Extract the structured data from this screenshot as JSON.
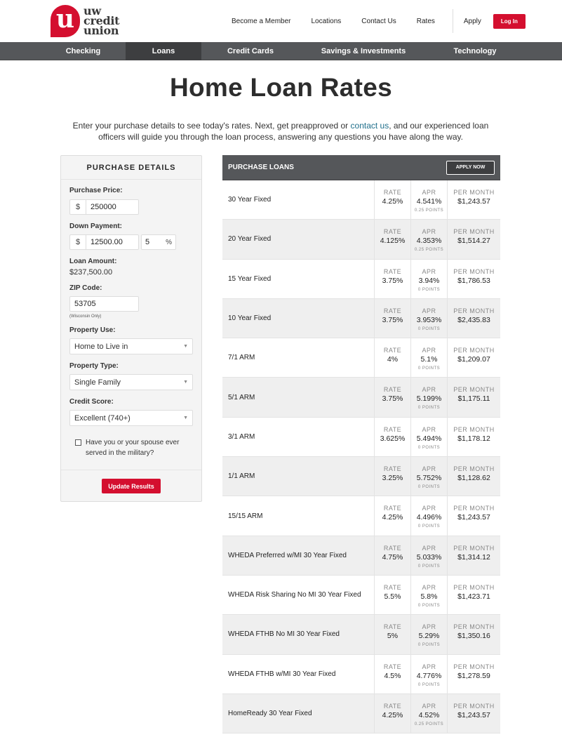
{
  "header": {
    "logo": {
      "mark": "u",
      "lines": [
        "uw",
        "credit",
        "union"
      ]
    },
    "top_links": [
      "Become a Member",
      "Locations",
      "Contact Us",
      "Rates"
    ],
    "apply_label": "Apply",
    "login_label": "Log In",
    "brand_color": "#d40f2f"
  },
  "main_nav": {
    "items": [
      {
        "label": "Checking",
        "active": false
      },
      {
        "label": "Loans",
        "active": true
      },
      {
        "label": "Credit Cards",
        "active": false
      },
      {
        "label": "Savings & Investments",
        "active": false
      },
      {
        "label": "Technology",
        "active": false
      }
    ]
  },
  "page": {
    "title": "Home Loan Rates",
    "intro_before": "Enter your purchase details to see today's rates. Next, get preapproved or ",
    "intro_link": "contact us",
    "intro_after": ", and our experienced loan officers will guide you through the loan process, answering any questions you have along the way."
  },
  "form": {
    "heading": "PURCHASE DETAILS",
    "purchase_price_label": "Purchase Price:",
    "currency_symbol": "$",
    "purchase_price": "250000",
    "down_payment_label": "Down Payment:",
    "down_payment": "12500.00",
    "down_payment_pct": "5",
    "pct_symbol": "%",
    "loan_amount_label": "Loan Amount:",
    "loan_amount": "$237,500.00",
    "zip_label": "ZIP Code:",
    "zip": "53705",
    "zip_hint": "(Wisconsin Only)",
    "property_use_label": "Property Use:",
    "property_use": "Home to Live in",
    "property_type_label": "Property Type:",
    "property_type": "Single Family",
    "credit_score_label": "Credit Score:",
    "credit_score": "Excellent (740+)",
    "military_label": "Have you or your spouse ever served in the military?",
    "military_checked": false,
    "update_label": "Update Results"
  },
  "rates": {
    "heading": "PURCHASE LOANS",
    "apply_now_label": "APPLY NOW",
    "col_labels": {
      "rate": "RATE",
      "apr": "APR",
      "per_month": "PER MONTH"
    },
    "rows": [
      {
        "name": "30 Year Fixed",
        "rate": "4.25%",
        "apr": "4.541%",
        "points": "0.25 POINTS",
        "per_month": "$1,243.57"
      },
      {
        "name": "20 Year Fixed",
        "rate": "4.125%",
        "apr": "4.353%",
        "points": "0.25 POINTS",
        "per_month": "$1,514.27"
      },
      {
        "name": "15 Year Fixed",
        "rate": "3.75%",
        "apr": "3.94%",
        "points": "0 POINTS",
        "per_month": "$1,786.53"
      },
      {
        "name": "10 Year Fixed",
        "rate": "3.75%",
        "apr": "3.953%",
        "points": "0 POINTS",
        "per_month": "$2,435.83"
      },
      {
        "name": "7/1 ARM",
        "rate": "4%",
        "apr": "5.1%",
        "points": "0 POINTS",
        "per_month": "$1,209.07"
      },
      {
        "name": "5/1 ARM",
        "rate": "3.75%",
        "apr": "5.199%",
        "points": "0 POINTS",
        "per_month": "$1,175.11"
      },
      {
        "name": "3/1 ARM",
        "rate": "3.625%",
        "apr": "5.494%",
        "points": "0 POINTS",
        "per_month": "$1,178.12"
      },
      {
        "name": "1/1 ARM",
        "rate": "3.25%",
        "apr": "5.752%",
        "points": "0 POINTS",
        "per_month": "$1,128.62"
      },
      {
        "name": "15/15 ARM",
        "rate": "4.25%",
        "apr": "4.496%",
        "points": "0 POINTS",
        "per_month": "$1,243.57"
      },
      {
        "name": "WHEDA Preferred w/MI 30 Year Fixed",
        "rate": "4.75%",
        "apr": "5.033%",
        "points": "0 POINTS",
        "per_month": "$1,314.12"
      },
      {
        "name": "WHEDA Risk Sharing No MI 30 Year Fixed",
        "rate": "5.5%",
        "apr": "5.8%",
        "points": "0 POINTS",
        "per_month": "$1,423.71"
      },
      {
        "name": "WHEDA FTHB No MI 30 Year Fixed",
        "rate": "5%",
        "apr": "5.29%",
        "points": "0 POINTS",
        "per_month": "$1,350.16"
      },
      {
        "name": "WHEDA FTHB w/MI 30 Year Fixed",
        "rate": "4.5%",
        "apr": "4.776%",
        "points": "0 POINTS",
        "per_month": "$1,278.59"
      },
      {
        "name": "HomeReady 30 Year Fixed",
        "rate": "4.25%",
        "apr": "4.52%",
        "points": "0.25 POINTS",
        "per_month": "$1,243.57"
      }
    ]
  }
}
